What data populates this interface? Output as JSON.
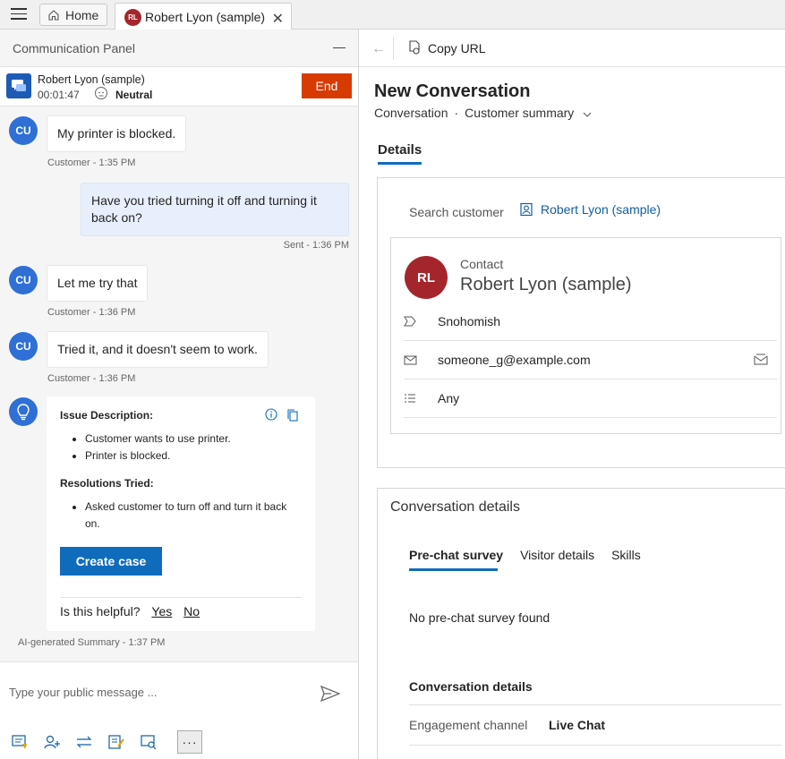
{
  "tabs": {
    "home_label": "Home",
    "contact_tab_label": "Robert Lyon (sample)",
    "contact_tab_initials": "RL"
  },
  "panel": {
    "title": "Communication Panel",
    "session": {
      "name": "Robert Lyon (sample)",
      "timer": "00:01:47",
      "sentiment": "Neutral",
      "end_label": "End"
    },
    "messages": [
      {
        "avatar": "CU",
        "text": "My printer is blocked.",
        "meta": "Customer - 1:35 PM"
      },
      {
        "text": "Have you tried turning it off and turning it back on?",
        "meta": "Sent - 1:36 PM"
      },
      {
        "avatar": "CU",
        "text": "Let me try that",
        "meta": "Customer - 1:36 PM"
      },
      {
        "avatar": "CU",
        "text": "Tried it, and it doesn't seem to work.",
        "meta": "Customer - 1:36 PM"
      }
    ],
    "summary": {
      "issue_heading": "Issue Description:",
      "issue_items": [
        "Customer wants to use printer.",
        "Printer is blocked."
      ],
      "resolutions_heading": "Resolutions Tried:",
      "resolution_items": [
        "Asked customer to turn off and turn it back on."
      ],
      "create_case_label": "Create case",
      "helpful_label": "Is this helpful?",
      "yes_label": "Yes",
      "no_label": "No",
      "meta": "AI-generated Summary - 1:37 PM"
    },
    "compose": {
      "placeholder": "Type your public message ...",
      "more_label": "···"
    }
  },
  "record": {
    "copy_url_label": "Copy URL",
    "title": "New Conversation",
    "subtitle_entity": "Conversation",
    "subtitle_form": "Customer summary",
    "details_tab": "Details",
    "search_customer_label": "Search customer",
    "customer_link": "Robert Lyon (sample)",
    "contact": {
      "initials": "RL",
      "type": "Contact",
      "name": "Robert Lyon (sample)",
      "city": "Snohomish",
      "email": "someone_g@example.com",
      "preferred": "Any"
    },
    "conversation_details": {
      "title": "Conversation details",
      "tabs": [
        "Pre-chat survey",
        "Visitor details",
        "Skills"
      ],
      "empty_text": "No pre-chat survey found",
      "section_title": "Conversation details",
      "engagement_label": "Engagement channel",
      "engagement_value": "Live Chat"
    }
  },
  "colors": {
    "accent": "#0f6cbd",
    "end_button": "#d83b01",
    "avatar_cu": "#2f6fd6",
    "avatar_rl": "#a4262c"
  }
}
